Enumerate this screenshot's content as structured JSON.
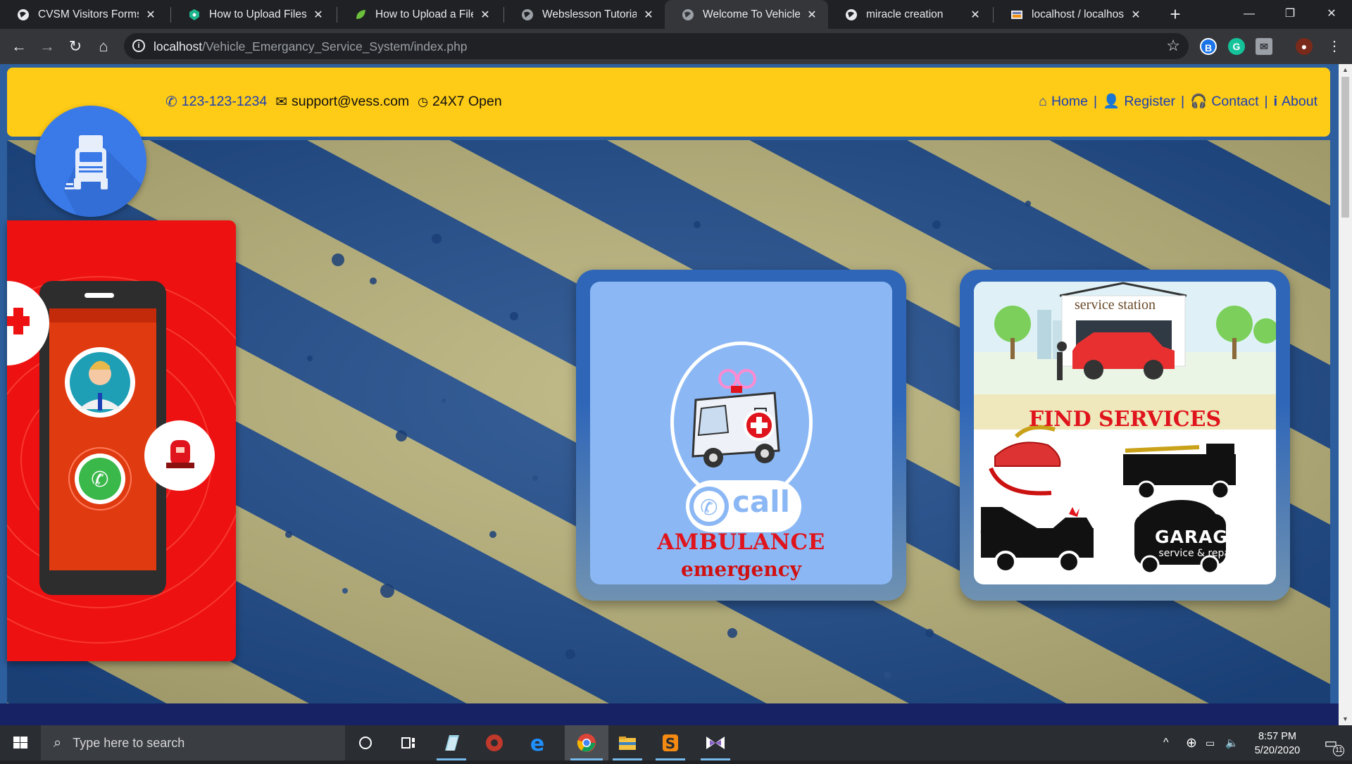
{
  "browser": {
    "tabs": [
      {
        "title": "CVSM Visitors Forms",
        "active": false
      },
      {
        "title": "How to Upload Files on",
        "active": false
      },
      {
        "title": "How to Upload a File in",
        "active": false
      },
      {
        "title": "Webslesson Tutorial",
        "active": false
      },
      {
        "title": "Welcome To Vehicle Em",
        "active": true
      },
      {
        "title": "miracle creation",
        "active": false
      },
      {
        "title": "localhost / localhost / m",
        "active": false
      }
    ],
    "url_host": "localhost",
    "url_path": "/Vehicle_Emergancy_Service_System/index.php"
  },
  "header": {
    "phone": "123-123-1234",
    "email": "support@vess.com",
    "hours": "24X7 Open",
    "nav": [
      {
        "label": "Home",
        "icon": "home-icon"
      },
      {
        "label": "Register",
        "icon": "user-icon"
      },
      {
        "label": "Contact",
        "icon": "headset-icon"
      },
      {
        "label": "About",
        "icon": "info-icon"
      }
    ]
  },
  "cards": {
    "ambulance": {
      "call_text": "call",
      "title": "AMBULANCE",
      "subtitle": "emergency"
    },
    "services": {
      "station_label": "service station",
      "title": "FIND SERVICES",
      "garage_title": "GARAGE",
      "garage_sub": "service & repair"
    }
  },
  "taskbar": {
    "search_placeholder": "Type here to search",
    "time": "8:57 PM",
    "date": "5/20/2020",
    "notification_count": "11"
  },
  "colors": {
    "header_yellow": "#fecb16",
    "nav_blue": "#1a3fb5",
    "ambulance_red": "#e0141c",
    "hero_blue": "#1d4a8a",
    "hero_khaki": "#b9b27a"
  }
}
